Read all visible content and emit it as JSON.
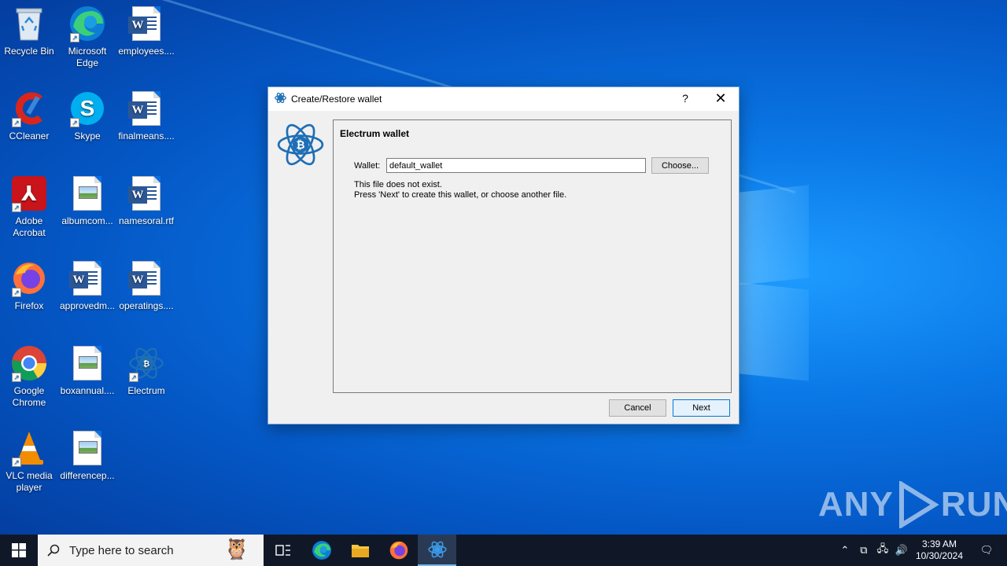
{
  "desktop": {
    "icons": [
      {
        "label": "Recycle Bin"
      },
      {
        "label": "Microsoft Edge"
      },
      {
        "label": "employees...."
      },
      {
        "label": "CCleaner"
      },
      {
        "label": "Skype"
      },
      {
        "label": "finalmeans...."
      },
      {
        "label": "Adobe Acrobat"
      },
      {
        "label": "albumcom..."
      },
      {
        "label": "namesoral.rtf"
      },
      {
        "label": "Firefox"
      },
      {
        "label": "approvedm..."
      },
      {
        "label": "operatings...."
      },
      {
        "label": "Google Chrome"
      },
      {
        "label": "boxannual...."
      },
      {
        "label": "Electrum"
      },
      {
        "label": "VLC media player"
      },
      {
        "label": "differencep..."
      }
    ]
  },
  "dialog": {
    "title": "Create/Restore wallet",
    "help_label": "?",
    "close_label": "✕",
    "heading": "Electrum wallet",
    "wallet_label": "Wallet:",
    "wallet_value": "default_wallet",
    "choose_label": "Choose...",
    "info_line1": "This file does not exist.",
    "info_line2": "Press 'Next' to create this wallet, or choose another file.",
    "cancel_label": "Cancel",
    "next_label": "Next"
  },
  "watermark": {
    "text_left": "ANY",
    "text_right": "RUN"
  },
  "taskbar": {
    "search_placeholder": "Type here to search",
    "time": "3:39 AM",
    "date": "10/30/2024"
  },
  "colors": {
    "accent": "#0078d7",
    "electrum_blue": "#1e6fb5",
    "taskbar": "#101828"
  }
}
